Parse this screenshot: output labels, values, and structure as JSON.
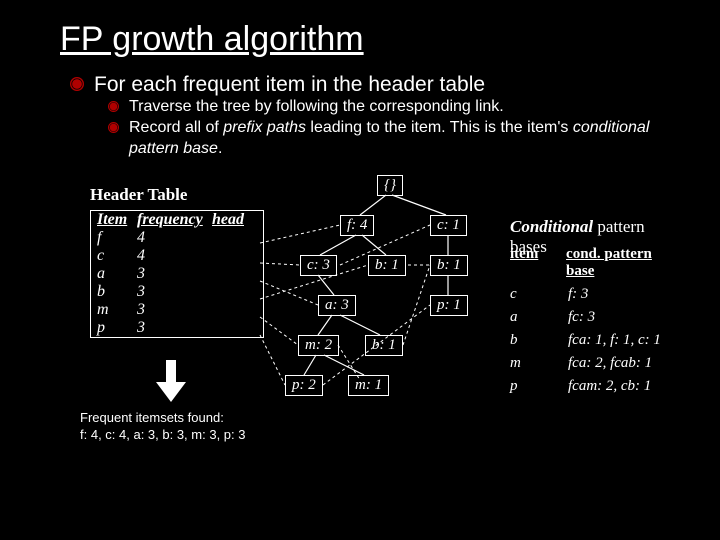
{
  "title": "FP growth algorithm",
  "bullets": {
    "main": "For each frequent item in the header table",
    "sub1": "Traverse the tree by following the corresponding link.",
    "sub2_a": "Record all of ",
    "sub2_b": "prefix paths",
    "sub2_c": " leading to the item. This is the item's ",
    "sub2_d": "conditional pattern base",
    "sub2_e": "."
  },
  "header_table": {
    "title": "Header Table",
    "cols": {
      "c1": "Item",
      "c2": "frequency",
      "c3": "head"
    },
    "rows": [
      {
        "item": "f",
        "freq": "4"
      },
      {
        "item": "c",
        "freq": "4"
      },
      {
        "item": "a",
        "freq": "3"
      },
      {
        "item": "b",
        "freq": "3"
      },
      {
        "item": "m",
        "freq": "3"
      },
      {
        "item": "p",
        "freq": "3"
      }
    ]
  },
  "frequent": {
    "line1": "Frequent itemsets found:",
    "line2": "f: 4, c: 4, a: 3, b: 3, m: 3, p: 3"
  },
  "tree": {
    "root": "{}",
    "f4": "f: 4",
    "c1": "c: 1",
    "c3": "c: 3",
    "b1a": "b: 1",
    "b1b": "b: 1",
    "a3": "a: 3",
    "p1": "p: 1",
    "m2": "m: 2",
    "b1c": "b: 1",
    "p2": "p: 2",
    "m1": "m: 1"
  },
  "cpb": {
    "title_a": "Conditional",
    "title_b": " pattern bases",
    "cols": {
      "c1": "item",
      "c2": "cond. pattern base"
    },
    "rows": [
      {
        "item": "c",
        "base": "f: 3"
      },
      {
        "item": "a",
        "base": "fc: 3"
      },
      {
        "item": "b",
        "base": "fca: 1, f: 1, c: 1"
      },
      {
        "item": "m",
        "base": "fca: 2, fcab: 1"
      },
      {
        "item": "p",
        "base": "fcam: 2, cb: 1"
      }
    ]
  }
}
